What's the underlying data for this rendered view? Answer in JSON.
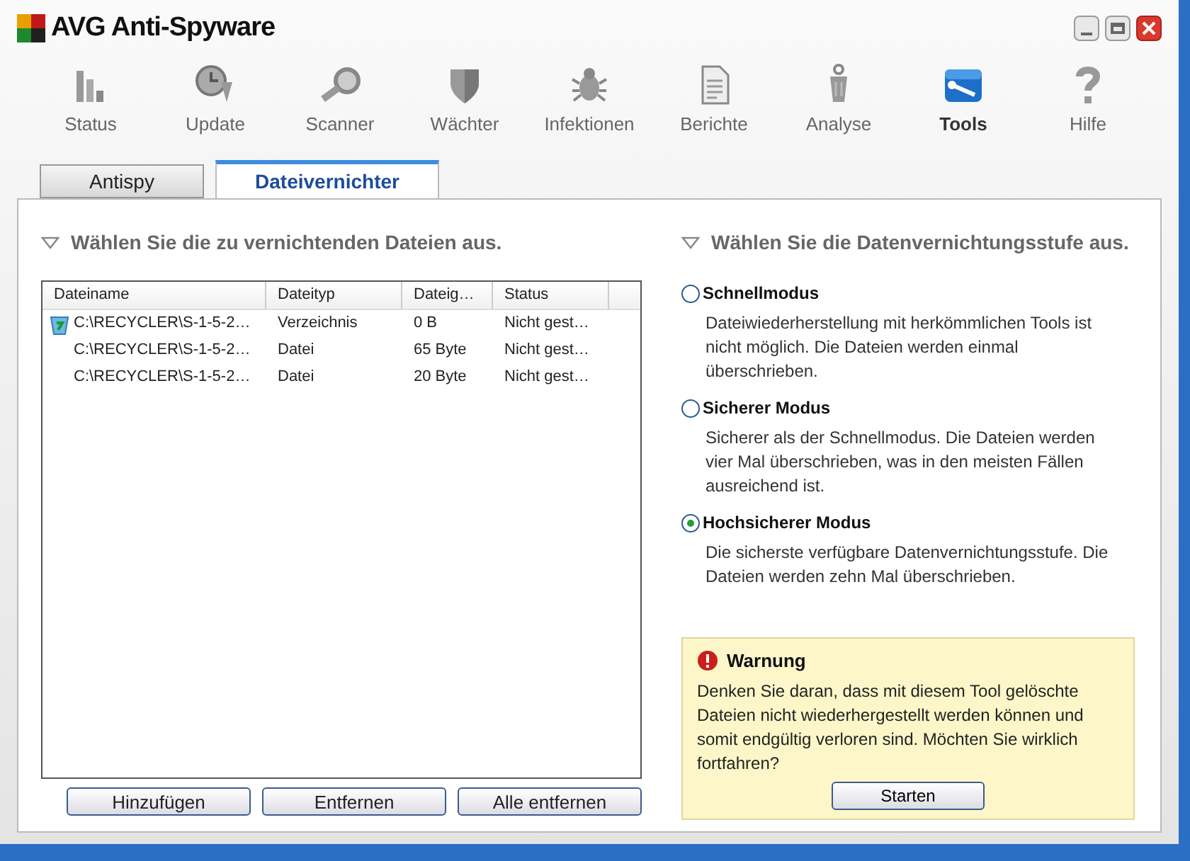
{
  "window": {
    "title": "AVG Anti-Spyware"
  },
  "toolbar": [
    {
      "label": "Status",
      "selected": false
    },
    {
      "label": "Update",
      "selected": false
    },
    {
      "label": "Scanner",
      "selected": false
    },
    {
      "label": "Wächter",
      "selected": false
    },
    {
      "label": "Infektionen",
      "selected": false
    },
    {
      "label": "Berichte",
      "selected": false
    },
    {
      "label": "Analyse",
      "selected": false
    },
    {
      "label": "Tools",
      "selected": true
    },
    {
      "label": "Hilfe",
      "selected": false
    }
  ],
  "tabs": [
    {
      "label": "Antispy",
      "selected": false
    },
    {
      "label": "Dateivernichter",
      "selected": true
    }
  ],
  "files": {
    "heading": "Wählen Sie die zu vernichtenden Dateien aus.",
    "columns": [
      "Dateiname",
      "Dateityp",
      "Dateig…",
      "Status"
    ],
    "rows": [
      {
        "kind": "folder",
        "cells": [
          "C:\\RECYCLER\\S-1-5-2…",
          "Verzeichnis",
          "0 B",
          "Nicht gest…"
        ]
      },
      {
        "kind": "file",
        "cells": [
          "C:\\RECYCLER\\S-1-5-2…",
          "Datei",
          "65 Byte",
          "Nicht gest…"
        ]
      },
      {
        "kind": "file",
        "cells": [
          "C:\\RECYCLER\\S-1-5-2…",
          "Datei",
          "20 Byte",
          "Nicht gest…"
        ]
      }
    ],
    "buttons": [
      "Hinzufügen",
      "Entfernen",
      "Alle entfernen"
    ]
  },
  "level": {
    "heading": "Wählen Sie die Datenvernichtungsstufe aus.",
    "options": [
      {
        "label": "Schnellmodus",
        "selected": false,
        "description": "Dateiwiederherstellung mit herkömmlichen Tools ist nicht möglich. Die Dateien werden einmal überschrieben."
      },
      {
        "label": "Sicherer Modus",
        "selected": false,
        "description": "Sicherer als der Schnellmodus. Die Dateien werden vier Mal überschrieben, was in den meisten Fällen ausreichend ist."
      },
      {
        "label": "Hochsicherer Modus",
        "selected": true,
        "description": "Die sicherste verfügbare Datenvernichtungsstufe. Die Dateien werden zehn Mal überschrieben."
      }
    ]
  },
  "warning": {
    "title": "Warnung",
    "text": "Denken Sie daran, dass mit diesem Tool gelöschte Dateien nicht wiederhergestellt werden können und somit endgültig verloren sind. Möchten Sie wirklich fortfahren?",
    "button": "Starten"
  }
}
